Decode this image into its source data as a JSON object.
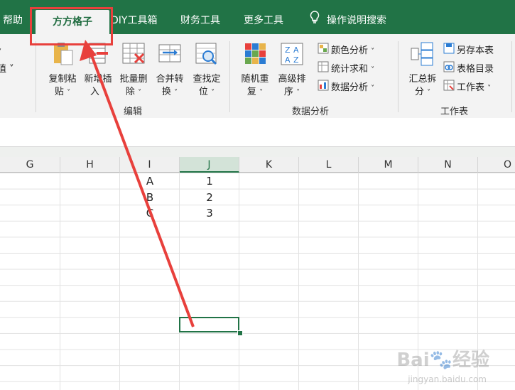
{
  "tabs": [
    "帮助",
    "方方格子",
    "DIY工具箱",
    "财务工具",
    "更多工具",
    "操作说明搜索"
  ],
  "active_tab": "方方格子",
  "ribbon": {
    "left_partial": [
      "值"
    ],
    "edit_group": {
      "label": "编辑",
      "buttons": [
        {
          "line1": "复制粘",
          "line2": "贴"
        },
        {
          "line1": "新增插",
          "line2": "入"
        },
        {
          "line1": "批量删",
          "line2": "除"
        },
        {
          "line1": "合并转",
          "line2": "换"
        },
        {
          "line1": "查找定",
          "line2": "位"
        }
      ]
    },
    "data_group": {
      "label": "数据分析",
      "buttons": [
        {
          "line1": "随机重",
          "line2": "复"
        },
        {
          "line1": "高级排",
          "line2": "序"
        }
      ],
      "small": [
        "颜色分析",
        "统计求和",
        "数据分析"
      ]
    },
    "sheet_group": {
      "label": "工作表",
      "button": {
        "line1": "汇总拆",
        "line2": "分"
      },
      "small": [
        "另存本表",
        "表格目录",
        "工作表"
      ]
    }
  },
  "columns": [
    "G",
    "H",
    "I",
    "J",
    "K",
    "L",
    "M",
    "N",
    "O"
  ],
  "selected_column": "J",
  "cells": {
    "I": [
      "A",
      "B",
      "C"
    ],
    "J": [
      "1",
      "2",
      "3"
    ]
  },
  "watermark": {
    "brand": "Bai",
    "suffix": "经验",
    "url": "jingyan.baidu.com"
  },
  "colors": {
    "excel_green": "#217346",
    "annotation_red": "#e8403c"
  }
}
